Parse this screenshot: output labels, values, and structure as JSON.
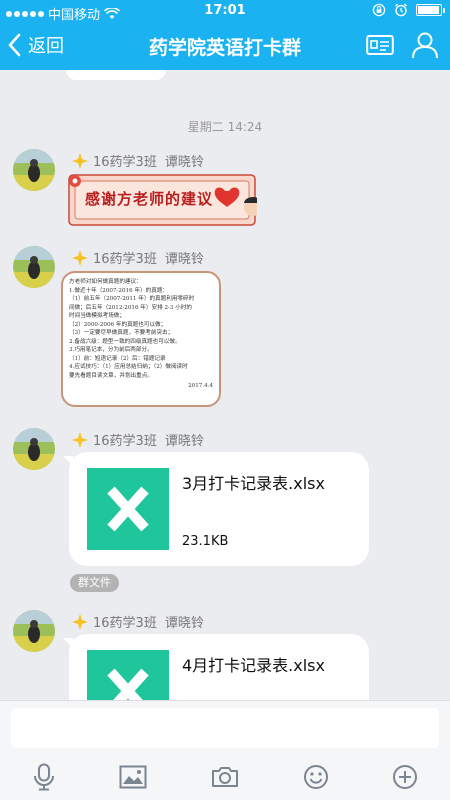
{
  "status": {
    "carrier": "中国移动",
    "time": "17:01"
  },
  "nav": {
    "back_label": "返回",
    "title": "药学院英语打卡群"
  },
  "chat": {
    "timestamp": "星期二 14:24",
    "messages": [
      {
        "sender_class": "16药学3班",
        "sender_name": "谭晓铃",
        "type": "sticker",
        "sticker_text": "感谢方老师的建议"
      },
      {
        "sender_class": "16药学3班",
        "sender_name": "谭晓铃",
        "type": "image-note",
        "note_lines": [
          "方老师对如何做真题的建议：",
          "1.做近十年（2007-2016 年）的真题：",
          "（1）前五年（2007-2011 年）的真题利用零碎时",
          "间做；后五年（2012-2016 年）安排 2-3 小时的",
          "时间当做模拟考场做；",
          "（2）2000-2006 年的真题也可以做；",
          "（3）一定要尽早做真题，不要考前突击；",
          "2.备战六级：题型一致的四级真题也可以做。",
          "3.巧用笔记本，分为前后两部分。",
          "（1）前：短语记录（2）后：错题记录",
          "4.应试技巧：（1）应用总结归纳；（2）做阅读时",
          "要先看题目读文章，并划出重点。"
        ],
        "note_date": "2017.4.4"
      },
      {
        "sender_class": "16药学3班",
        "sender_name": "谭晓铃",
        "type": "file",
        "file_name": "3月打卡记录表.xlsx",
        "file_size": "23.1KB"
      },
      {
        "sender_class": "16药学3班",
        "sender_name": "谭晓铃",
        "type": "file",
        "file_name": "4月打卡记录表.xlsx"
      }
    ],
    "group_file_tag": "群文件"
  },
  "colors": {
    "accent": "#1ab2f0",
    "excel_green": "#1fc59b",
    "background": "#ebecf0"
  },
  "icons": {
    "toolbar": [
      "microphone-icon",
      "image-icon",
      "camera-icon",
      "emoji-icon",
      "plus-icon"
    ]
  }
}
